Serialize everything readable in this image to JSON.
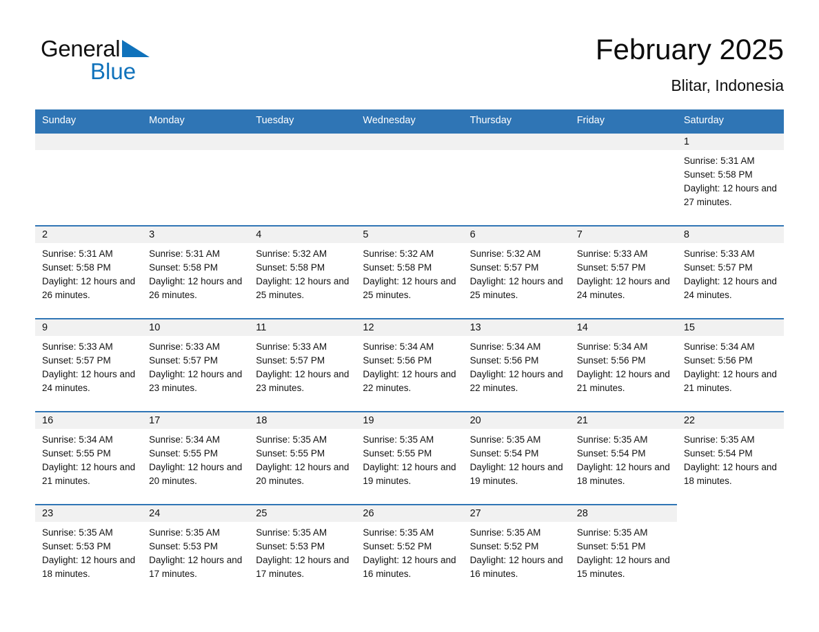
{
  "brand": {
    "name_part1": "General",
    "name_part2": "Blue",
    "triangle_color": "#1072bb"
  },
  "header": {
    "month_title": "February 2025",
    "location": "Blitar, Indonesia"
  },
  "theme": {
    "header_blue": "#2f75b5",
    "daynum_band": "#f1f1f1",
    "text": "#111111"
  },
  "weekdays": [
    "Sunday",
    "Monday",
    "Tuesday",
    "Wednesday",
    "Thursday",
    "Friday",
    "Saturday"
  ],
  "weeks": [
    [
      {
        "day": "",
        "blank": true
      },
      {
        "day": "",
        "blank": true
      },
      {
        "day": "",
        "blank": true
      },
      {
        "day": "",
        "blank": true
      },
      {
        "day": "",
        "blank": true
      },
      {
        "day": "",
        "blank": true
      },
      {
        "day": "1",
        "sunrise": "Sunrise: 5:31 AM",
        "sunset": "Sunset: 5:58 PM",
        "daylight": "Daylight: 12 hours and 27 minutes."
      }
    ],
    [
      {
        "day": "2",
        "sunrise": "Sunrise: 5:31 AM",
        "sunset": "Sunset: 5:58 PM",
        "daylight": "Daylight: 12 hours and 26 minutes."
      },
      {
        "day": "3",
        "sunrise": "Sunrise: 5:31 AM",
        "sunset": "Sunset: 5:58 PM",
        "daylight": "Daylight: 12 hours and 26 minutes."
      },
      {
        "day": "4",
        "sunrise": "Sunrise: 5:32 AM",
        "sunset": "Sunset: 5:58 PM",
        "daylight": "Daylight: 12 hours and 25 minutes."
      },
      {
        "day": "5",
        "sunrise": "Sunrise: 5:32 AM",
        "sunset": "Sunset: 5:58 PM",
        "daylight": "Daylight: 12 hours and 25 minutes."
      },
      {
        "day": "6",
        "sunrise": "Sunrise: 5:32 AM",
        "sunset": "Sunset: 5:57 PM",
        "daylight": "Daylight: 12 hours and 25 minutes."
      },
      {
        "day": "7",
        "sunrise": "Sunrise: 5:33 AM",
        "sunset": "Sunset: 5:57 PM",
        "daylight": "Daylight: 12 hours and 24 minutes."
      },
      {
        "day": "8",
        "sunrise": "Sunrise: 5:33 AM",
        "sunset": "Sunset: 5:57 PM",
        "daylight": "Daylight: 12 hours and 24 minutes."
      }
    ],
    [
      {
        "day": "9",
        "sunrise": "Sunrise: 5:33 AM",
        "sunset": "Sunset: 5:57 PM",
        "daylight": "Daylight: 12 hours and 24 minutes."
      },
      {
        "day": "10",
        "sunrise": "Sunrise: 5:33 AM",
        "sunset": "Sunset: 5:57 PM",
        "daylight": "Daylight: 12 hours and 23 minutes."
      },
      {
        "day": "11",
        "sunrise": "Sunrise: 5:33 AM",
        "sunset": "Sunset: 5:57 PM",
        "daylight": "Daylight: 12 hours and 23 minutes."
      },
      {
        "day": "12",
        "sunrise": "Sunrise: 5:34 AM",
        "sunset": "Sunset: 5:56 PM",
        "daylight": "Daylight: 12 hours and 22 minutes."
      },
      {
        "day": "13",
        "sunrise": "Sunrise: 5:34 AM",
        "sunset": "Sunset: 5:56 PM",
        "daylight": "Daylight: 12 hours and 22 minutes."
      },
      {
        "day": "14",
        "sunrise": "Sunrise: 5:34 AM",
        "sunset": "Sunset: 5:56 PM",
        "daylight": "Daylight: 12 hours and 21 minutes."
      },
      {
        "day": "15",
        "sunrise": "Sunrise: 5:34 AM",
        "sunset": "Sunset: 5:56 PM",
        "daylight": "Daylight: 12 hours and 21 minutes."
      }
    ],
    [
      {
        "day": "16",
        "sunrise": "Sunrise: 5:34 AM",
        "sunset": "Sunset: 5:55 PM",
        "daylight": "Daylight: 12 hours and 21 minutes."
      },
      {
        "day": "17",
        "sunrise": "Sunrise: 5:34 AM",
        "sunset": "Sunset: 5:55 PM",
        "daylight": "Daylight: 12 hours and 20 minutes."
      },
      {
        "day": "18",
        "sunrise": "Sunrise: 5:35 AM",
        "sunset": "Sunset: 5:55 PM",
        "daylight": "Daylight: 12 hours and 20 minutes."
      },
      {
        "day": "19",
        "sunrise": "Sunrise: 5:35 AM",
        "sunset": "Sunset: 5:55 PM",
        "daylight": "Daylight: 12 hours and 19 minutes."
      },
      {
        "day": "20",
        "sunrise": "Sunrise: 5:35 AM",
        "sunset": "Sunset: 5:54 PM",
        "daylight": "Daylight: 12 hours and 19 minutes."
      },
      {
        "day": "21",
        "sunrise": "Sunrise: 5:35 AM",
        "sunset": "Sunset: 5:54 PM",
        "daylight": "Daylight: 12 hours and 18 minutes."
      },
      {
        "day": "22",
        "sunrise": "Sunrise: 5:35 AM",
        "sunset": "Sunset: 5:54 PM",
        "daylight": "Daylight: 12 hours and 18 minutes."
      }
    ],
    [
      {
        "day": "23",
        "sunrise": "Sunrise: 5:35 AM",
        "sunset": "Sunset: 5:53 PM",
        "daylight": "Daylight: 12 hours and 18 minutes."
      },
      {
        "day": "24",
        "sunrise": "Sunrise: 5:35 AM",
        "sunset": "Sunset: 5:53 PM",
        "daylight": "Daylight: 12 hours and 17 minutes."
      },
      {
        "day": "25",
        "sunrise": "Sunrise: 5:35 AM",
        "sunset": "Sunset: 5:53 PM",
        "daylight": "Daylight: 12 hours and 17 minutes."
      },
      {
        "day": "26",
        "sunrise": "Sunrise: 5:35 AM",
        "sunset": "Sunset: 5:52 PM",
        "daylight": "Daylight: 12 hours and 16 minutes."
      },
      {
        "day": "27",
        "sunrise": "Sunrise: 5:35 AM",
        "sunset": "Sunset: 5:52 PM",
        "daylight": "Daylight: 12 hours and 16 minutes."
      },
      {
        "day": "28",
        "sunrise": "Sunrise: 5:35 AM",
        "sunset": "Sunset: 5:51 PM",
        "daylight": "Daylight: 12 hours and 15 minutes."
      },
      {
        "day": "",
        "empty_tail": true
      }
    ]
  ]
}
